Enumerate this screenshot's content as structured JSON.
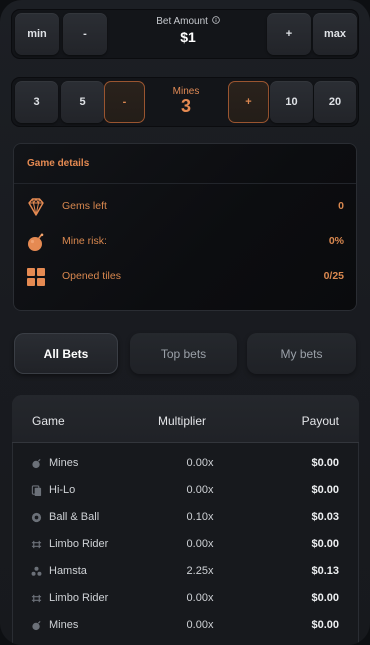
{
  "bet": {
    "min_label": "min",
    "minus_label": "-",
    "amount_label": "Bet Amount",
    "info_icon": "info-icon",
    "amount_value": "$1",
    "plus_label": "+",
    "max_label": "max"
  },
  "mines": {
    "preset_3": "3",
    "preset_5": "5",
    "minus_label": "-",
    "label": "Mines",
    "value": "3",
    "plus_label": "+",
    "preset_10": "10",
    "preset_20": "20"
  },
  "details": {
    "title": "Game details",
    "rows": [
      {
        "icon": "diamond-icon",
        "label": "Gems left",
        "value": "0"
      },
      {
        "icon": "bomb-icon",
        "label": "Mine risk:",
        "value": "0%"
      },
      {
        "icon": "grid-icon",
        "label": "Opened tiles",
        "value": "0/25"
      }
    ],
    "accent": "#e58a52"
  },
  "tabs": [
    {
      "label": "All Bets",
      "active": true
    },
    {
      "label": "Top bets",
      "active": false
    },
    {
      "label": "My bets",
      "active": false
    }
  ],
  "table": {
    "headers": {
      "game": "Game",
      "multiplier": "Multiplier",
      "payout": "Payout"
    },
    "rows": [
      {
        "icon": "mines-icon",
        "game": "Mines",
        "multiplier": "0.00x",
        "payout": "$0.00"
      },
      {
        "icon": "hilo-icon",
        "game": "Hi-Lo",
        "multiplier": "0.00x",
        "payout": "$0.00"
      },
      {
        "icon": "ball-icon",
        "game": "Ball & Ball",
        "multiplier": "0.10x",
        "payout": "$0.03"
      },
      {
        "icon": "limbo-icon",
        "game": "Limbo Rider",
        "multiplier": "0.00x",
        "payout": "$0.00"
      },
      {
        "icon": "hamsta-icon",
        "game": "Hamsta",
        "multiplier": "2.25x",
        "payout": "$0.13"
      },
      {
        "icon": "limbo-icon",
        "game": "Limbo Rider",
        "multiplier": "0.00x",
        "payout": "$0.00"
      },
      {
        "icon": "mines-icon",
        "game": "Mines",
        "multiplier": "0.00x",
        "payout": "$0.00"
      }
    ]
  }
}
